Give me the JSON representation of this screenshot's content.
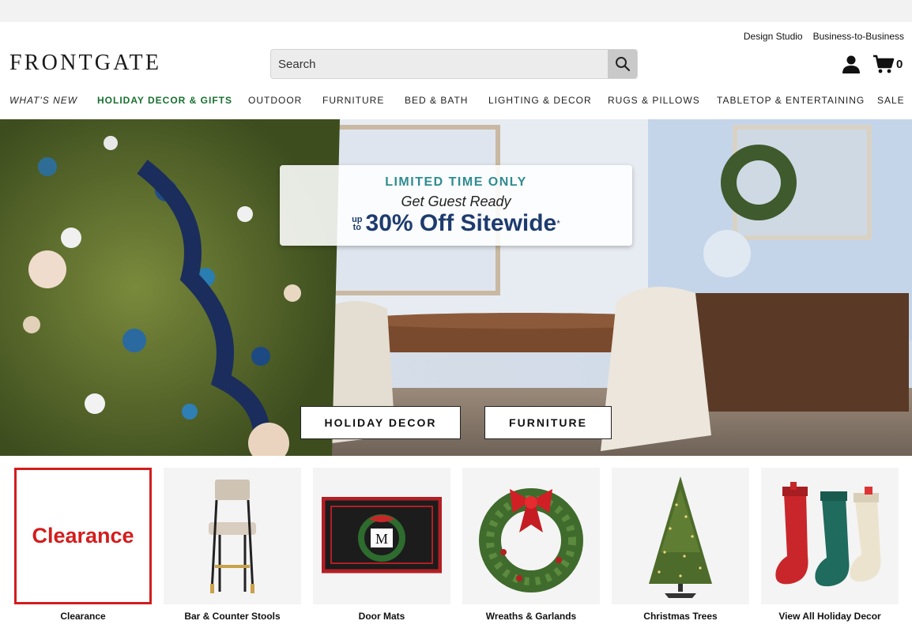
{
  "utility_links": [
    "Design Studio",
    "Business-to-Business"
  ],
  "brand": {
    "logo": "FRONTGATE"
  },
  "search": {
    "placeholder": "Search"
  },
  "cart": {
    "count": "0"
  },
  "nav": [
    "WHAT'S NEW",
    "HOLIDAY DECOR & GIFTS",
    "OUTDOOR",
    "FURNITURE",
    "BED & BATH",
    "LIGHTING & DECOR",
    "RUGS & PILLOWS",
    "TABLETOP & ENTERTAINING",
    "SALE"
  ],
  "hero": {
    "kicker": "LIMITED TIME ONLY",
    "subtitle": "Get Guest Ready",
    "upto_line1": "up",
    "upto_line2": "to",
    "offer": "30% Off Sitewide",
    "asterisk": "*",
    "buttons": [
      "HOLIDAY DECOR",
      "FURNITURE"
    ]
  },
  "categories": [
    {
      "label": "Clearance",
      "tile_text": "Clearance"
    },
    {
      "label": "Bar & Counter Stools"
    },
    {
      "label": "Door Mats",
      "mat_letter": "M"
    },
    {
      "label": "Wreaths & Garlands"
    },
    {
      "label": "Christmas Trees"
    },
    {
      "label": "View All Holiday Decor"
    }
  ],
  "colors": {
    "holiday_nav": "#17702f",
    "promo_teal": "#2e8c91",
    "promo_navy": "#1d3b6e",
    "clearance_red": "#d31d1d"
  },
  "icons": [
    "search-icon",
    "account-icon",
    "cart-icon"
  ]
}
